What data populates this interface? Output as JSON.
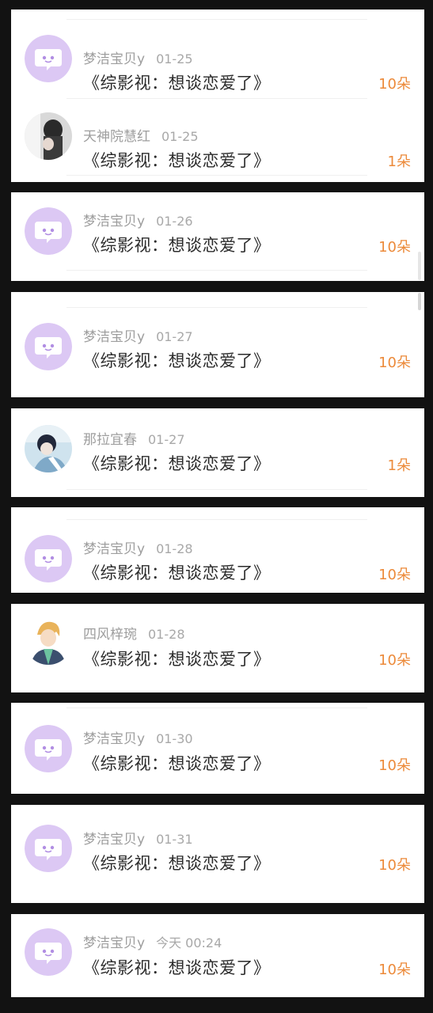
{
  "colors": {
    "background": "#121212",
    "card": "#ffffff",
    "username": "#9e9e9e",
    "title": "#2b2b2b",
    "amount": "#ec8a3a",
    "default_avatar_bg": "#dcc8f4",
    "default_avatar_icon": "#ffffff"
  },
  "entries": [
    {
      "avatar": "chat-bubble-icon",
      "username": "梦洁宝贝y",
      "time": "01-25",
      "title": "《综影视：想谈恋爱了》",
      "amount": "10朵"
    },
    {
      "avatar": "user-photo",
      "username": "天神院慧红",
      "time": "01-25",
      "title": "《综影视：想谈恋爱了》",
      "amount": "1朵"
    },
    {
      "avatar": "chat-bubble-icon",
      "username": "梦洁宝贝y",
      "time": "01-26",
      "title": "《综影视：想谈恋爱了》",
      "amount": "10朵"
    },
    {
      "avatar": "chat-bubble-icon",
      "username": "梦洁宝贝y",
      "time": "01-27",
      "title": "《综影视：想谈恋爱了》",
      "amount": "10朵"
    },
    {
      "avatar": "user-photo",
      "username": "那拉宜春",
      "time": "01-27",
      "title": "《综影视：想谈恋爱了》",
      "amount": "1朵"
    },
    {
      "avatar": "chat-bubble-icon",
      "username": "梦洁宝贝y",
      "time": "01-28",
      "title": "《综影视：想谈恋爱了》",
      "amount": "10朵"
    },
    {
      "avatar": "user-photo",
      "username": "四风梓琬",
      "time": "01-28",
      "title": "《综影视：想谈恋爱了》",
      "amount": "10朵"
    },
    {
      "avatar": "chat-bubble-icon",
      "username": "梦洁宝贝y",
      "time": "01-30",
      "title": "《综影视：想谈恋爱了》",
      "amount": "10朵"
    },
    {
      "avatar": "chat-bubble-icon",
      "username": "梦洁宝贝y",
      "time": "01-31",
      "title": "《综影视：想谈恋爱了》",
      "amount": "10朵"
    },
    {
      "avatar": "chat-bubble-icon",
      "username": "梦洁宝贝y",
      "time": "今天 00:24",
      "title": "《综影视：想谈恋爱了》",
      "amount": "10朵"
    }
  ]
}
